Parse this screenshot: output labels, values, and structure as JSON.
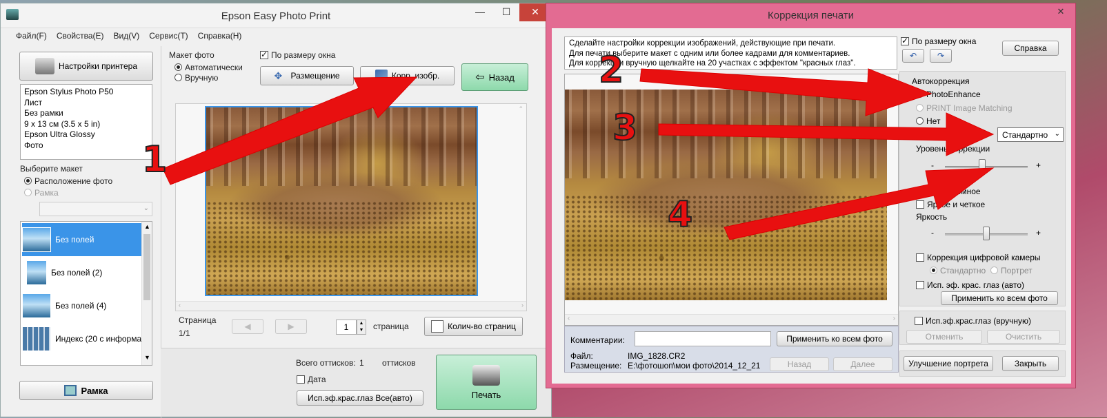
{
  "left_window": {
    "title": "Epson Easy Photo Print",
    "menu": [
      "Файл(F)",
      "Свойства(E)",
      "Вид(V)",
      "Сервис(T)",
      "Справка(H)"
    ],
    "printer_settings_button": "Настройки принтера",
    "printer_info": [
      "Epson Stylus Photo P50",
      "Лист",
      "Без рамки",
      "9 x 13 см (3.5 x 5 in)",
      "Epson Ultra Glossy",
      "Фото"
    ],
    "choose_layout_label": "Выберите макет",
    "layout_options": [
      "Расположение фото",
      "Рамка"
    ],
    "layout_list": [
      "Без полей",
      "Без полей (2)",
      "Без полей (4)",
      "Индекс (20 с информа"
    ],
    "frame_button": "Рамка",
    "photo_layout_label": "Макет фото",
    "photo_layout_options": [
      "Автоматически",
      "Вручную"
    ],
    "fit_window_label": "По размеру окна",
    "placement_button": "Размещение",
    "correct_image_button": "Корр. изобр.",
    "back_button": "Назад",
    "page_label": "Страница",
    "page_value": "1/1",
    "page_count_value": "1",
    "page_word": "страница",
    "page_count_button": "Колич-во страниц",
    "total_prints_label": "Всего оттисков:",
    "total_prints_value": "1",
    "prints_word": "оттисков",
    "date_label": "Дата",
    "redeye_all_button": "Исп.эф.крас.глаз Все(авто)",
    "print_button": "Печать"
  },
  "right_window": {
    "title": "Коррекция печати",
    "info_lines": [
      "Сделайте настройки коррекции изображений, действующие при печати.",
      "Для печати выберите макет с одним или более кадрами для комментариев.",
      "Для коррекции вручную щелкайте на 20 участках с эффектом \"красных глаз\"."
    ],
    "fit_window_label": "По размеру окна",
    "help_button": "Справка",
    "autocorrection_label": "Автокоррекция",
    "auto_options": [
      "PhotoEnhance",
      "PRINT Image Matching",
      "Нет"
    ],
    "scene_select_value": "Стандартно",
    "correction_level_label": "Уровень коррекции",
    "minus": "-",
    "plus": "+",
    "correction_level": 0.45,
    "monochrome_label": "Монохромное",
    "vivid_label": "Яркое и четкое",
    "brightness_label": "Яркость",
    "brightness_level": 0.5,
    "camera_correction_label": "Коррекция цифровой камеры",
    "camera_options": [
      "Стандартно",
      "Портрет"
    ],
    "redeye_auto_label": "Исп. эф. крас. глаз (авто)",
    "apply_all_button": "Применить ко всем фото",
    "redeye_manual_label": "Исп.эф.крас.глаз (вручную)",
    "cancel_button": "Отменить",
    "clear_button": "Очистить",
    "comments_label": "Комментарии:",
    "comment_apply_button": "Применить ко всем фото",
    "file_label": "Файл:",
    "file_value": "IMG_1828.CR2",
    "location_label": "Размещение:",
    "location_value": "E:\\фотошоп\\мои фото\\2014_12_21",
    "back_button": "Назад",
    "next_button": "Далее",
    "portrait_button": "Улучшение портрета",
    "close_button": "Закрыть"
  },
  "annotations": [
    "1",
    "2",
    "3",
    "4"
  ],
  "colors": {
    "arrow": "#e81010",
    "selection": "#3a94e8",
    "correction_titlebar": "#e36b92",
    "print_button": "#8dd9ab"
  }
}
